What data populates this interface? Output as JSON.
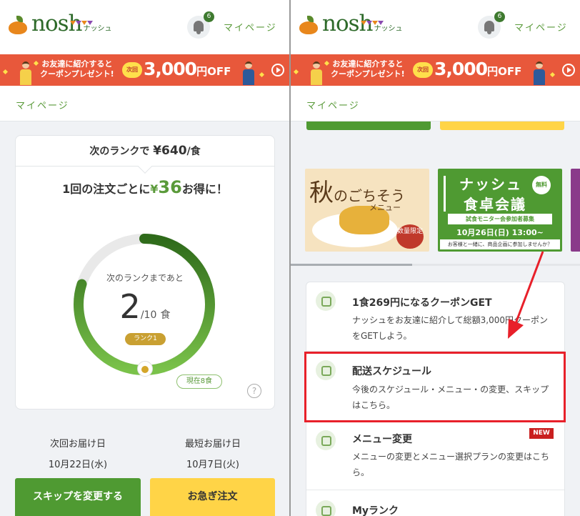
{
  "header": {
    "logo_text": "nosh",
    "logo_kana": "ナッシュ",
    "notification_count": "6",
    "mypage_label": "マイページ"
  },
  "banner": {
    "line1": "お友達に紹介すると",
    "line2": "クーポンプレゼント!",
    "next_label": "次回",
    "amount": "3,000",
    "amount_suffix": "円OFF"
  },
  "breadcrumb": "マイページ",
  "left": {
    "rank_header_prefix": "次のランクで",
    "rank_header_price": "¥640",
    "rank_header_suffix": "/食",
    "per_order_prefix": "1回の注文ごとに",
    "per_order_currency": "¥",
    "per_order_amount": "36",
    "per_order_suffix": "お得に！",
    "ring_label": "次のランクまであと",
    "ring_count": "2",
    "ring_total": "/10",
    "ring_unit": "食",
    "ring_progress": 0.8,
    "rank_chip": "ランク1",
    "current_chip": "現在8食",
    "help": "?",
    "next_delivery_label": "次回お届け日",
    "next_delivery_date": "10月22日(水)",
    "earliest_delivery_label": "最短お届け日",
    "earliest_delivery_date": "10月7日(火)",
    "skip_button": "スキップを変更する",
    "urgent_button": "お急ぎ注文"
  },
  "right": {
    "promo1": {
      "title_big": "秋",
      "title_small": "のごちそう",
      "sub": "メニュー",
      "badge": "数量限定"
    },
    "promo2": {
      "line1": "ナッシュ",
      "free": "無料",
      "line2": "食卓会議",
      "line3": "試食モニター会参加者募集",
      "line4": "10月26日(日) 13:00~",
      "line5": "お客様と一緒に、商品企画に参加しませんか？"
    },
    "menu": [
      {
        "title": "1食269円になるクーポンGET",
        "desc": "ナッシュをお友達に紹介して総額3,000円クーポンをGETしよう。"
      },
      {
        "title": "配送スケジュール",
        "desc": "今後のスケジュール・メニュー・の変更、スキップはこちら。"
      },
      {
        "title": "メニュー変更",
        "desc": "メニューの変更とメニュー選択プランの変更はこちら。",
        "badge": "NEW"
      },
      {
        "title": "Myランク",
        "desc": ""
      }
    ]
  },
  "colors": {
    "brand_green": "#4f9a32",
    "accent_yellow": "#ffd447",
    "banner_red": "#e8583b",
    "highlight_red": "#e8202a"
  }
}
